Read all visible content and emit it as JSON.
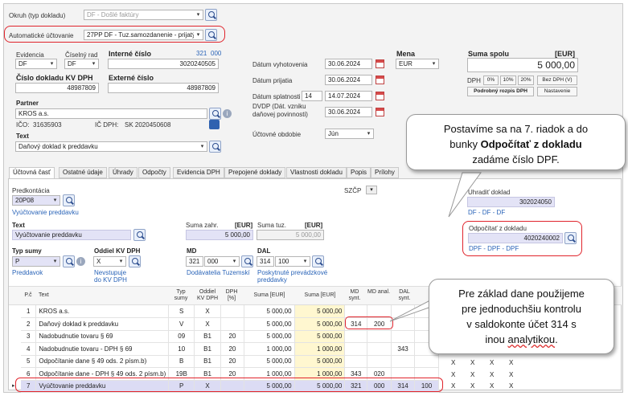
{
  "top": {
    "okruh_label": "Okruh (typ dokladu)",
    "okruh_value": "DF - Došlé faktúry",
    "auto_label": "Automatické účtovanie",
    "auto_value": "27PP DF - Tuz.samozdanenie - prijatý"
  },
  "header": {
    "evidencia_label": "Evidencia",
    "evidencia_value": "DF",
    "ciselny_rad_label": "Číselný rad",
    "ciselny_rad_value": "DF",
    "interne_label": "Interné číslo",
    "interne_counter": "321",
    "interne_counter2": "000",
    "interne_value": "3020240505",
    "kvdph_label": "Číslo dokladu KV DPH",
    "kvdph_value": "48987809",
    "externe_label": "Externé číslo",
    "externe_value": "48987809",
    "partner_label": "Partner",
    "partner_value": "KROS a.s.",
    "ico_label": "IČO:",
    "ico_value": "31635903",
    "icdph_label": "IČ DPH:",
    "icdph_value": "SK 2020450608",
    "text_label": "Text",
    "text_value": "Daňový doklad k preddavku",
    "datum_vyhotovenia_label": "Dátum vyhotovenia",
    "datum_vyhotovenia": "30.06.2024",
    "datum_prijatia_label": "Dátum prijatia",
    "datum_prijatia": "30.06.2024",
    "datum_splatnosti_label": "Dátum splatnosti",
    "splatnost_days": "14",
    "datum_splatnosti": "14.07.2024",
    "dvdp_label1": "DVDP (Dát. vzniku",
    "dvdp_label2": "daňovej povinnosti)",
    "dvdp_value": "30.06.2024",
    "obdobie_label": "Účtovné obdobie",
    "obdobie_value": "Jún",
    "mena_label": "Mena",
    "mena_value": "EUR",
    "suma_label": "Suma spolu",
    "suma_currency": "[EUR]",
    "suma_value": "5 000,00",
    "dph_label": "DPH",
    "dph_buttons": [
      "0%",
      "10%",
      "20%",
      "Bez DPH (V)"
    ],
    "rozpis_button": "Podrobný rozpis DPH",
    "nastavenie_button": "Nastavenie"
  },
  "tabs": [
    "Účtovná časť",
    "Ostatné údaje",
    "Úhrady",
    "Odpočty",
    "Evidencia DPH",
    "Prepojené doklady",
    "Vlastnosti dokladu",
    "Popis",
    "Prílohy"
  ],
  "body": {
    "predkontacia_label": "Predkontácia",
    "predkontacia_value": "20P08",
    "predkontacia_desc": "Vyúčtovanie preddavku",
    "szcp_label": "SZČP",
    "uhradit_label": "Uhradiť doklad",
    "uhradit_value": "302024050",
    "uhradit_desc": "DF - DF - DF",
    "odpocitat_label": "Odpočítať z dokladu",
    "odpocitat_value": "4020240002",
    "odpocitat_desc": "DPF - DPF - DPF",
    "text_label": "Text",
    "text_value": "Vyúčtovanie preddavku",
    "suma_zahr_label": "Suma zahr.",
    "suma_zahr_cur": "[EUR]",
    "suma_zahr_value": "5 000,00",
    "suma_tuz_label": "Suma tuz.",
    "suma_tuz_cur": "[EUR]",
    "suma_tuz_value": "5 000,00",
    "typ_sumy_label": "Typ sumy",
    "typ_sumy_value": "P",
    "typ_sumy_desc": "Preddavok",
    "oddiel_label": "Oddiel KV DPH",
    "oddiel_value": "X",
    "oddiel_desc1": "Nevstupuje",
    "oddiel_desc2": "do KV DPH",
    "md_label": "MD",
    "md_synt": "321",
    "md_anal": "000",
    "md_desc": "Dodávatelia Tuzemskí",
    "dal_label": "DAL",
    "dal_synt": "314",
    "dal_anal": "100",
    "dal_desc1": "Poskytnuté prevádzkové",
    "dal_desc2": "preddavky"
  },
  "grid": {
    "headers": [
      "P.č",
      "Text",
      "Typ sumy",
      "Oddiel KV DPH",
      "DPH [%]",
      "Suma [EUR]",
      "Suma [EUR]",
      "MD synt.",
      "MD anal.",
      "DAL synt."
    ],
    "rows": [
      {
        "n": "1",
        "text": "KROS a.s.",
        "typ": "S",
        "oddiel": "X",
        "dph": "",
        "suma1": "5 000,00",
        "suma2": "5 000,00",
        "mds": "",
        "mda": "",
        "dals": "",
        "dala": ""
      },
      {
        "n": "2",
        "text": "Daňový doklad k preddavku",
        "typ": "V",
        "oddiel": "X",
        "dph": "",
        "suma1": "5 000,00",
        "suma2": "5 000,00",
        "mds": "314",
        "mda": "200",
        "dals": "",
        "dala": ""
      },
      {
        "n": "3",
        "text": "Nadobudnutie tovaru § 69",
        "typ": "09",
        "oddiel": "B1",
        "dph": "20",
        "suma1": "5 000,00",
        "suma2": "5 000,00",
        "mds": "",
        "mda": "",
        "dals": "",
        "dala": ""
      },
      {
        "n": "4",
        "text": "Nadobudnutie tovaru - DPH § 69",
        "typ": "10",
        "oddiel": "B1",
        "dph": "20",
        "suma1": "1 000,00",
        "suma2": "1 000,00",
        "mds": "",
        "mda": "",
        "dals": "343",
        "dala": ""
      },
      {
        "n": "5",
        "text": "Odpočítanie dane § 49 ods. 2 písm.b)",
        "typ": "B",
        "oddiel": "B1",
        "dph": "20",
        "suma1": "5 000,00",
        "suma2": "5 000,00",
        "mds": "",
        "mda": "",
        "dals": "",
        "dala": ""
      },
      {
        "n": "6",
        "text": "Odpočítanie dane - DPH § 49 ods. 2 písm.b)",
        "typ": "19B",
        "oddiel": "B1",
        "dph": "20",
        "suma1": "1 000,00",
        "suma2": "1 000,00",
        "mds": "343",
        "mda": "020",
        "dals": "",
        "dala": ""
      },
      {
        "n": "7",
        "text": "Vyúčtovanie preddavku",
        "typ": "P",
        "oddiel": "X",
        "dph": "",
        "suma1": "5 000,00",
        "suma2": "5 000,00",
        "mds": "321",
        "mda": "000",
        "dals": "314",
        "dala": "100"
      }
    ]
  },
  "callouts": {
    "c1_line1": "Postavíme sa na 7. riadok a do",
    "c1_line2a": "bunky ",
    "c1_line2b": "Odpočítať z dokladu",
    "c1_line3": "zadáme číslo DPF.",
    "c2_line1": "Pre základ dane použijeme",
    "c2_line2": "pre jednoduchšiu kontrolu",
    "c2_line3": "v saldokonte účet 314 s",
    "c2_line4a": "inou ",
    "c2_line4b": "analytikou",
    "c2_line4c": "."
  },
  "colors": {
    "accent_red": "#e0242c",
    "header_blue": "#2a64b8",
    "selected_row": "#dcdcf4",
    "lilac_field": "#e3e3f6"
  }
}
